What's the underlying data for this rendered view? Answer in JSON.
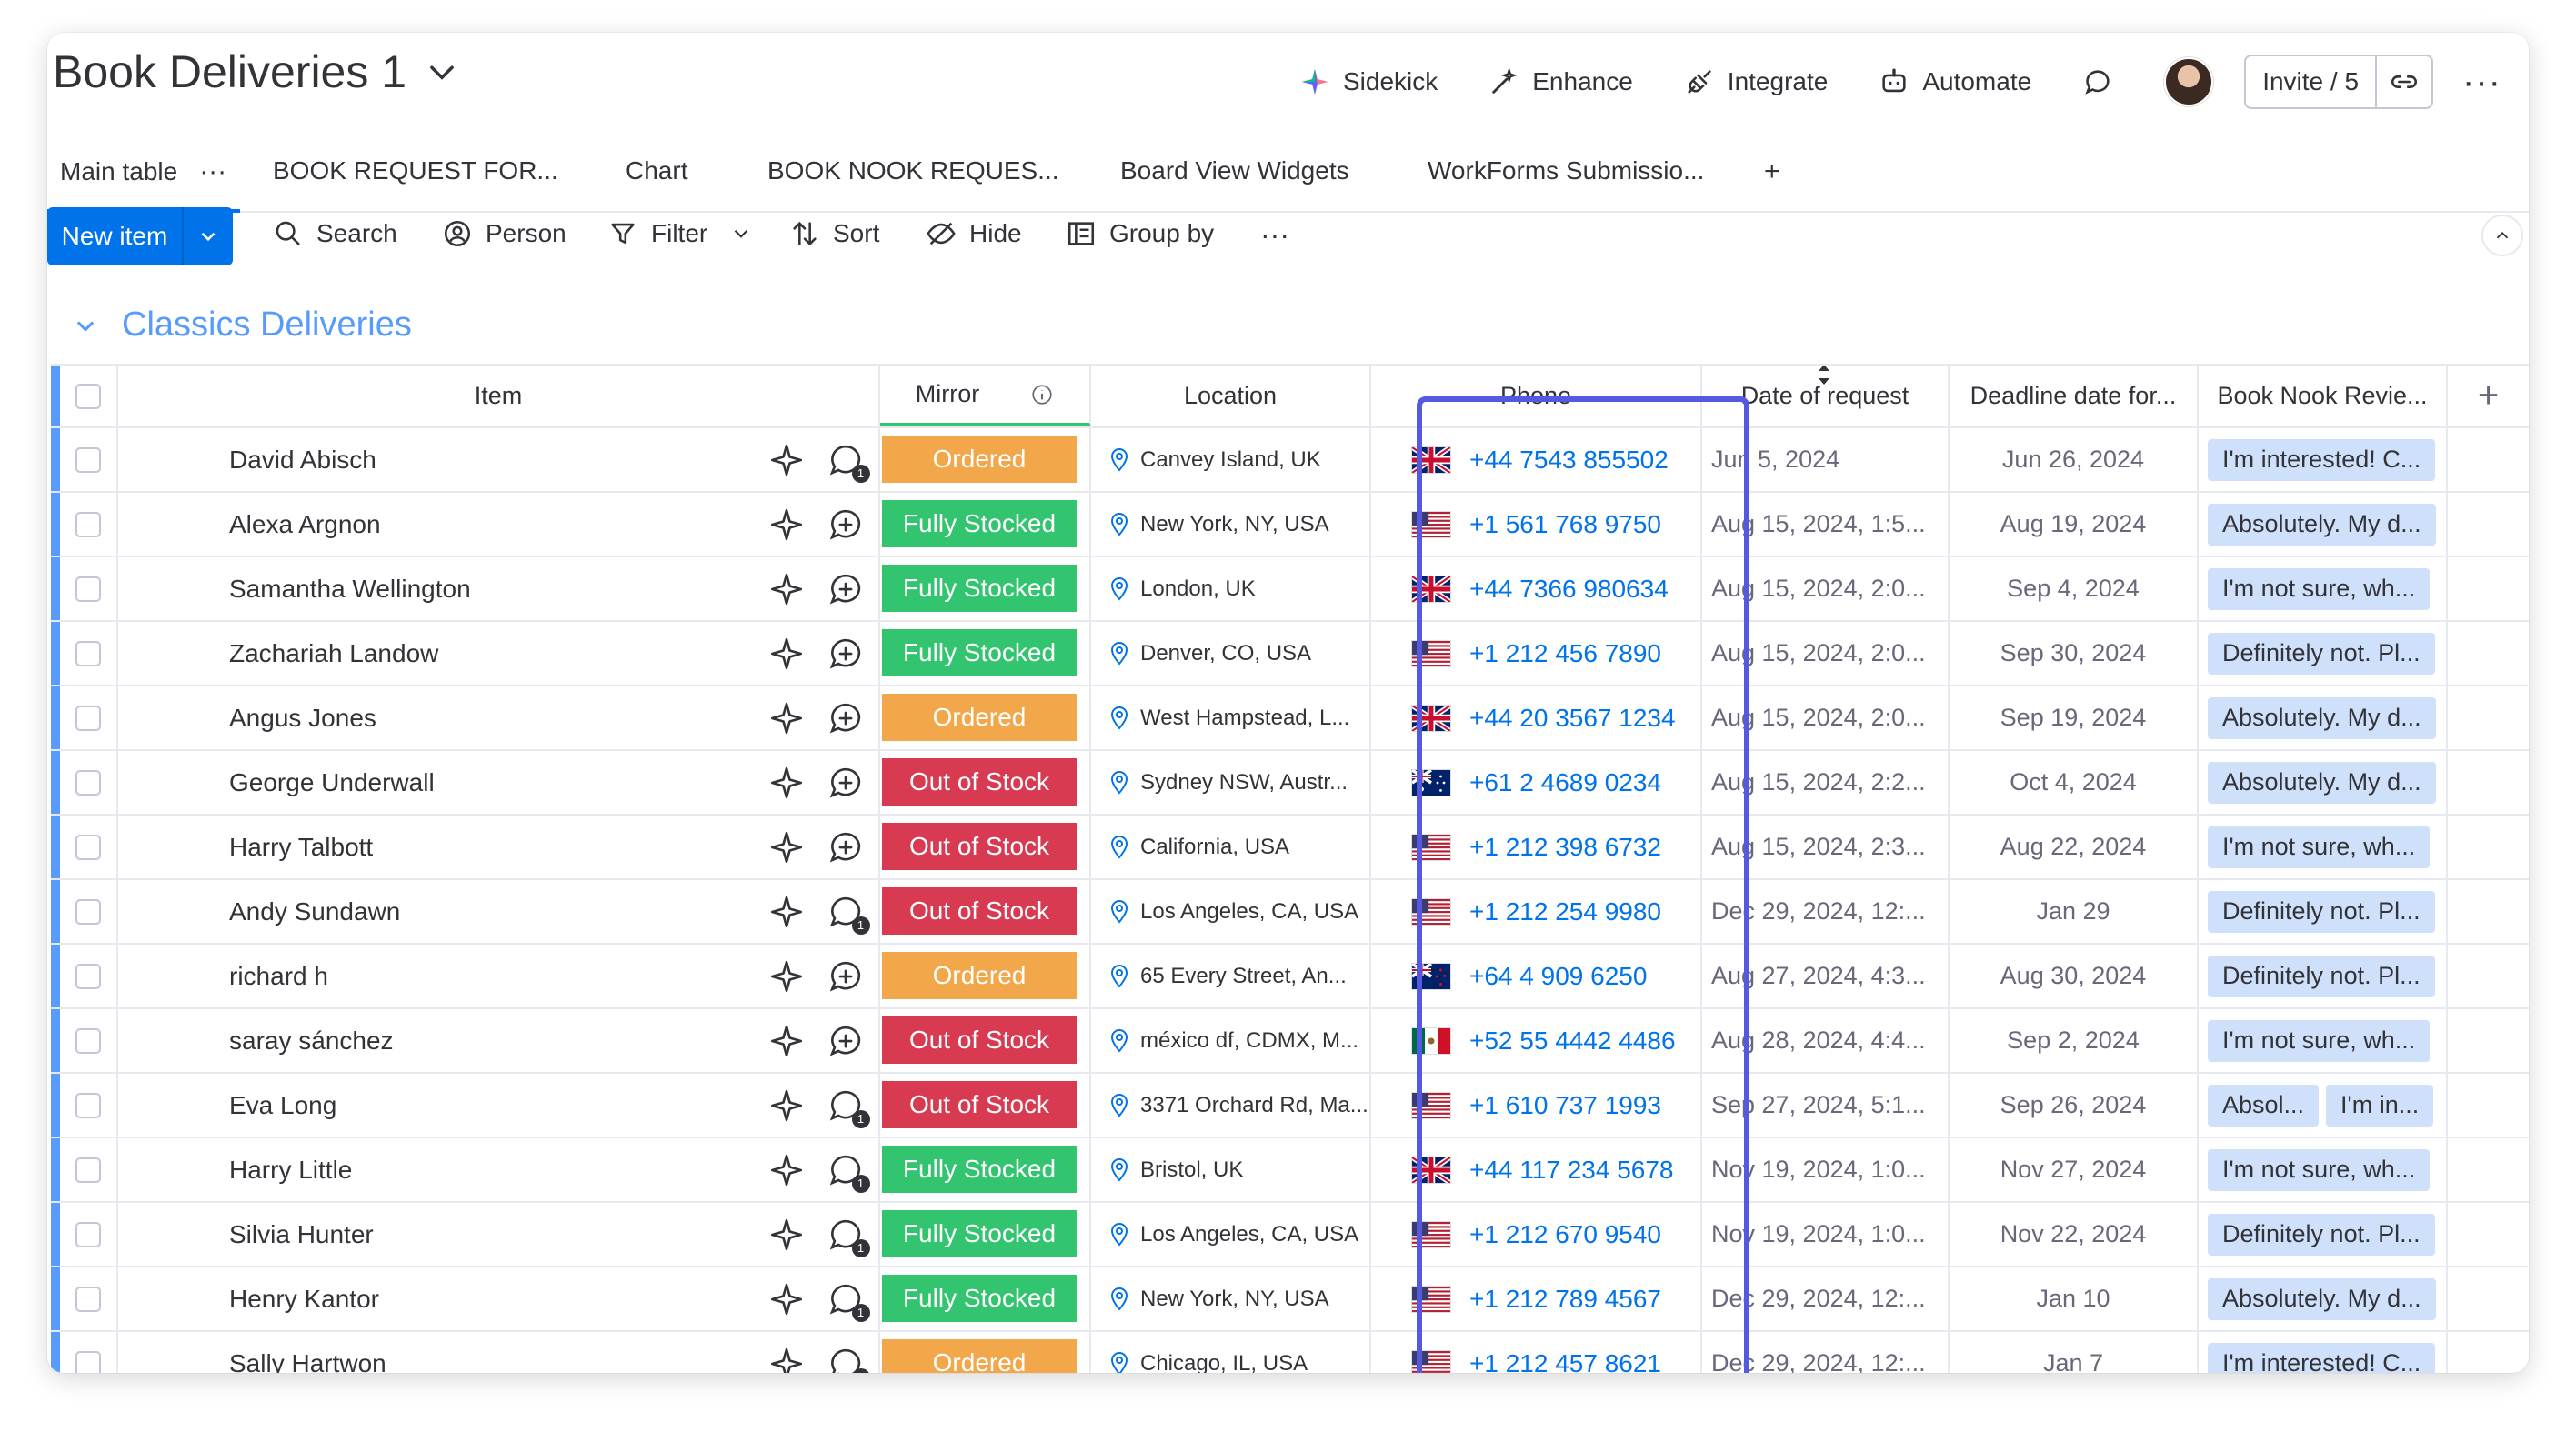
{
  "board": {
    "title": "Book Deliveries 1"
  },
  "header_actions": {
    "sidekick": "Sidekick",
    "enhance": "Enhance",
    "integrate": "Integrate",
    "automate": "Automate",
    "invite": "Invite / 5"
  },
  "tabs": [
    {
      "label": "Main table"
    },
    {
      "label": "BOOK REQUEST FOR..."
    },
    {
      "label": "Chart"
    },
    {
      "label": "BOOK NOOK REQUES..."
    },
    {
      "label": "Board View Widgets"
    },
    {
      "label": "WorkForms Submissio..."
    },
    {
      "label": "+"
    }
  ],
  "toolbar": {
    "new_item": "New item",
    "search": "Search",
    "person": "Person",
    "filter": "Filter",
    "sort": "Sort",
    "hide": "Hide",
    "group_by": "Group by"
  },
  "group": {
    "title": "Classics Deliveries"
  },
  "columns": {
    "item": "Item",
    "mirror": "Mirror",
    "location": "Location",
    "phone": "Phone",
    "date_request": "Date of request",
    "deadline": "Deadline date for...",
    "review": "Book Nook Revie..."
  },
  "status_colors": {
    "Ordered": "#f2a74b",
    "Fully Stocked": "#33c46f",
    "Out of Stock": "#d83a52"
  },
  "accent_colors": {
    "primary": "#0073ea",
    "group": "#579bfc",
    "highlight_frame": "#5559df"
  },
  "rows": [
    {
      "name": "David Abisch",
      "updates": 1,
      "status": "Ordered",
      "location": "Canvey Island, UK",
      "flag": "uk",
      "phone": "+44 7543 855502",
      "date": "Jun 5, 2024",
      "deadline": "Jun 26, 2024",
      "review": [
        "I'm interested! C..."
      ]
    },
    {
      "name": "Alexa Argnon",
      "updates": 0,
      "status": "Fully Stocked",
      "location": "New York, NY, USA",
      "flag": "us",
      "phone": "+1 561 768 9750",
      "date": "Aug 15, 2024, 1:5...",
      "deadline": "Aug 19, 2024",
      "review": [
        "Absolutely. My d..."
      ]
    },
    {
      "name": "Samantha Wellington",
      "updates": 0,
      "status": "Fully Stocked",
      "location": "London, UK",
      "flag": "uk",
      "phone": "+44 7366 980634",
      "date": "Aug 15, 2024, 2:0...",
      "deadline": "Sep 4, 2024",
      "review": [
        "I'm not sure, wh..."
      ]
    },
    {
      "name": "Zachariah Landow",
      "updates": 0,
      "status": "Fully Stocked",
      "location": "Denver, CO, USA",
      "flag": "us",
      "phone": "+1 212 456 7890",
      "date": "Aug 15, 2024, 2:0...",
      "deadline": "Sep 30, 2024",
      "review": [
        "Definitely not. Pl..."
      ]
    },
    {
      "name": "Angus Jones",
      "updates": 0,
      "status": "Ordered",
      "location": "West Hampstead, L...",
      "flag": "uk",
      "phone": "+44 20 3567 1234",
      "date": "Aug 15, 2024, 2:0...",
      "deadline": "Sep 19, 2024",
      "review": [
        "Absolutely. My d..."
      ]
    },
    {
      "name": "George Underwall",
      "updates": 0,
      "status": "Out of Stock",
      "location": "Sydney NSW, Austr...",
      "flag": "au",
      "phone": "+61 2 4689 0234",
      "date": "Aug 15, 2024, 2:2...",
      "deadline": "Oct 4, 2024",
      "review": [
        "Absolutely. My d..."
      ]
    },
    {
      "name": "Harry Talbott",
      "updates": 0,
      "status": "Out of Stock",
      "location": "California, USA",
      "flag": "us",
      "phone": "+1 212 398 6732",
      "date": "Aug 15, 2024, 2:3...",
      "deadline": "Aug 22, 2024",
      "review": [
        "I'm not sure, wh..."
      ]
    },
    {
      "name": "Andy Sundawn",
      "updates": 1,
      "status": "Out of Stock",
      "location": "Los Angeles, CA, USA",
      "flag": "us",
      "phone": "+1 212 254 9980",
      "date": "Dec 29, 2024, 12:...",
      "deadline": "Jan 29",
      "review": [
        "Definitely not. Pl..."
      ]
    },
    {
      "name": "richard h",
      "updates": 0,
      "status": "Ordered",
      "location": "65 Every Street, An...",
      "flag": "nz",
      "phone": "+64 4 909 6250",
      "date": "Aug 27, 2024, 4:3...",
      "deadline": "Aug 30, 2024",
      "review": [
        "Definitely not. Pl..."
      ]
    },
    {
      "name": "saray sánchez",
      "updates": 0,
      "status": "Out of Stock",
      "location": "méxico df, CDMX, M...",
      "flag": "mx",
      "phone": "+52 55 4442 4486",
      "date": "Aug 28, 2024, 4:4...",
      "deadline": "Sep 2, 2024",
      "review": [
        "I'm not sure, wh..."
      ]
    },
    {
      "name": "Eva Long",
      "updates": 1,
      "status": "Out of Stock",
      "location": "3371 Orchard Rd, Ma...",
      "flag": "us",
      "phone": "+1 610 737 1993",
      "date": "Sep 27, 2024, 5:1...",
      "deadline": "Sep 26, 2024",
      "review": [
        "Absol...",
        "I'm in..."
      ]
    },
    {
      "name": "Harry Little",
      "updates": 1,
      "status": "Fully Stocked",
      "location": "Bristol, UK",
      "flag": "uk",
      "phone": "+44 117 234 5678",
      "date": "Nov 19, 2024, 1:0...",
      "deadline": "Nov 27, 2024",
      "review": [
        "I'm not sure, wh..."
      ]
    },
    {
      "name": "Silvia Hunter",
      "updates": 1,
      "status": "Fully Stocked",
      "location": "Los Angeles, CA, USA",
      "flag": "us",
      "phone": "+1 212 670 9540",
      "date": "Nov 19, 2024, 1:0...",
      "deadline": "Nov 22, 2024",
      "review": [
        "Definitely not. Pl..."
      ]
    },
    {
      "name": "Henry Kantor",
      "updates": 1,
      "status": "Fully Stocked",
      "location": "New York, NY, USA",
      "flag": "us",
      "phone": "+1 212 789 4567",
      "date": "Dec 29, 2024, 12:...",
      "deadline": "Jan 10",
      "review": [
        "Absolutely. My d..."
      ]
    },
    {
      "name": "Sally Hartwon",
      "updates": 1,
      "status": "Ordered",
      "location": "Chicago, IL, USA",
      "flag": "us",
      "phone": "+1 212 457 8621",
      "date": "Dec 29, 2024, 12:...",
      "deadline": "Jan 7",
      "review": [
        "I'm interested! C..."
      ]
    }
  ]
}
